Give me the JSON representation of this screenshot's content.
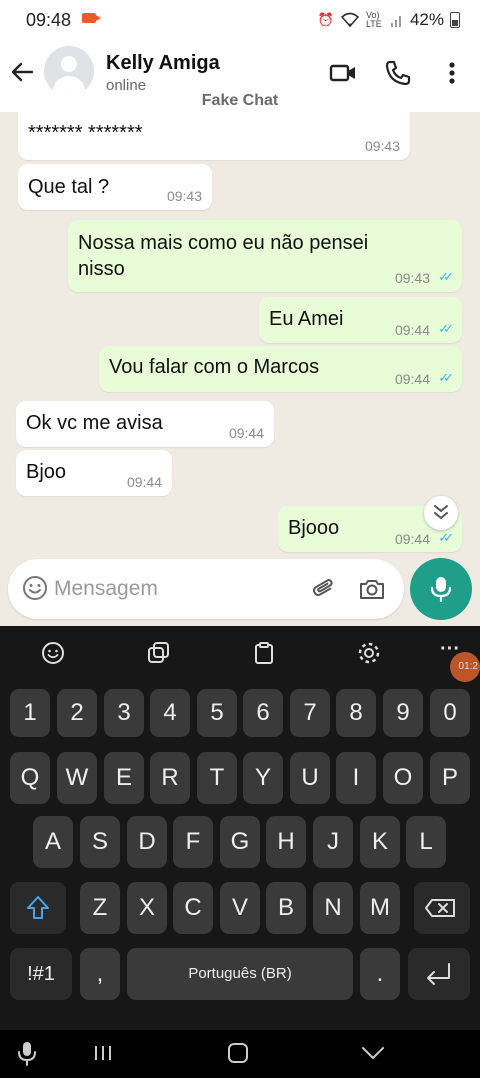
{
  "status_bar": {
    "time": "09:48",
    "battery": "42%",
    "volte": "Vo) LTE"
  },
  "header": {
    "contact_name": "Kelly Amiga",
    "contact_status": "online",
    "overlay_label": "Fake Chat"
  },
  "messages": [
    {
      "direction": "in",
      "text": "******* *******",
      "time": "09:43"
    },
    {
      "direction": "in",
      "text": "Que tal ?",
      "time": "09:43"
    },
    {
      "direction": "out",
      "text_line1": "Nossa mais como eu não pensei",
      "text_line2": "nisso",
      "time": "09:43",
      "read": true
    },
    {
      "direction": "out",
      "text": "Eu Amei",
      "time": "09:44",
      "read": true
    },
    {
      "direction": "out",
      "text": "Vou falar com o Marcos",
      "time": "09:44",
      "read": true
    },
    {
      "direction": "in",
      "text": "Ok vc me avisa",
      "time": "09:44"
    },
    {
      "direction": "in",
      "text": "Bjoo",
      "time": "09:44"
    },
    {
      "direction": "out",
      "text": "Bjooo",
      "time": "09:44",
      "read": true
    }
  ],
  "composer": {
    "placeholder": "Mensagem"
  },
  "keyboard": {
    "number_row": [
      "1",
      "2",
      "3",
      "4",
      "5",
      "6",
      "7",
      "8",
      "9",
      "0"
    ],
    "row1": [
      "Q",
      "W",
      "E",
      "R",
      "T",
      "Y",
      "U",
      "I",
      "O",
      "P"
    ],
    "row2": [
      "A",
      "S",
      "D",
      "F",
      "G",
      "H",
      "J",
      "K",
      "L"
    ],
    "row3": [
      "Z",
      "X",
      "C",
      "V",
      "B",
      "N",
      "M"
    ],
    "symbols_key": "!#1",
    "comma_key": ",",
    "space_label": "Português (BR)",
    "period_key": ".",
    "recording_timer": "01:2"
  },
  "colors": {
    "outgoing_bubble": "#e8fcd8",
    "incoming_bubble": "#ffffff",
    "chat_background": "#efeae2",
    "accent": "#1f9e8a",
    "read_ticks": "#34b7f1"
  }
}
